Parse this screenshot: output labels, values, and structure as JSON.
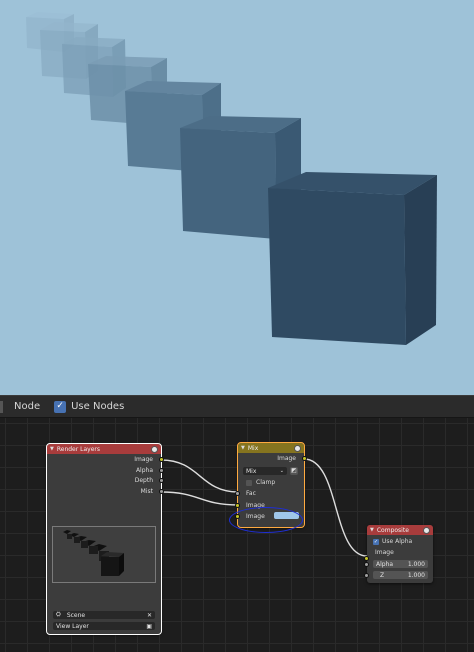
{
  "header": {
    "menu_node": "Node",
    "use_nodes_label": "Use Nodes",
    "use_nodes_checked": true
  },
  "nodes": {
    "render_layers": {
      "title": "Render Layers",
      "color": "#a83c3c",
      "outputs": [
        "Image",
        "Alpha",
        "Depth",
        "Mist"
      ],
      "scene_label": "Scene",
      "view_layer_label": "View Layer"
    },
    "mix": {
      "title": "Mix",
      "color": "#85741f",
      "output": "Image",
      "blend_mode": "Mix",
      "clamp_label": "Clamp",
      "inputs": [
        "Fac",
        "Image",
        "Image"
      ],
      "second_image_color": "#9fc6ea"
    },
    "composite": {
      "title": "Composite",
      "color": "#a83c3c",
      "use_alpha_label": "Use Alpha",
      "use_alpha_checked": true,
      "input_label": "Image",
      "alpha_label": "Alpha",
      "alpha_value": "1.000",
      "z_label": "Z",
      "z_value": "1.000"
    }
  },
  "colors": {
    "sky": "#9ec2d8",
    "highlight_annotation": "#1f2fd6",
    "image_socket": "#c7c729",
    "float_socket": "#a1a1a1",
    "vector_socket": "#6363c7"
  }
}
